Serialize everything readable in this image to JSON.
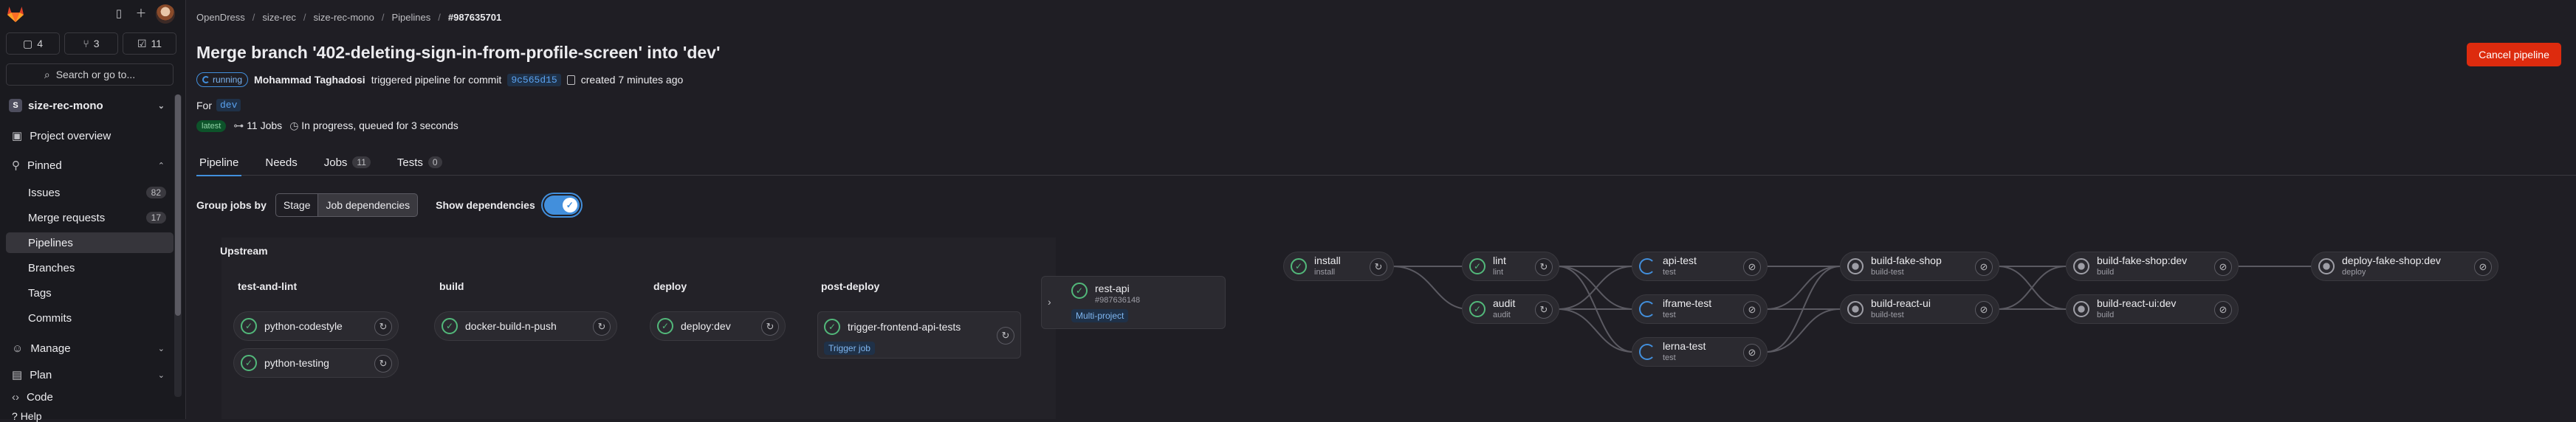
{
  "sidebar": {
    "counts": [
      {
        "icon": "issues-icon",
        "value": "4"
      },
      {
        "icon": "merge-request-icon",
        "value": "3"
      },
      {
        "icon": "todo-icon",
        "value": "11"
      }
    ],
    "search_label": "Search or go to...",
    "project": {
      "avatar_letter": "S",
      "name": "size-rec-mono"
    },
    "project_overview": "Project overview",
    "pinned_label": "Pinned",
    "pinned_items": [
      {
        "label": "Issues",
        "badge": "82"
      },
      {
        "label": "Merge requests",
        "badge": "17"
      },
      {
        "label": "Pipelines",
        "badge": ""
      },
      {
        "label": "Branches",
        "badge": ""
      },
      {
        "label": "Tags",
        "badge": ""
      },
      {
        "label": "Commits",
        "badge": ""
      }
    ],
    "manage_label": "Manage",
    "plan_label": "Plan",
    "code_label": "Code",
    "help_label": "Help"
  },
  "breadcrumb": [
    "OpenDress",
    "size-rec",
    "size-rec-mono",
    "Pipelines",
    "#987635701"
  ],
  "header": {
    "title": "Merge branch '402-deleting-sign-in-from-profile-screen' into 'dev'",
    "cancel_label": "Cancel pipeline",
    "status_label": "running",
    "author": "Mohammad Taghadosi",
    "trigger_text": "triggered pipeline for commit",
    "commit_sha": "9c565d15",
    "created_text": "created 7 minutes ago",
    "for_label": "For",
    "ref": "dev",
    "latest_badge": "latest",
    "jobs_text": "11 Jobs",
    "progress_text": "In progress, queued for 3 seconds"
  },
  "tabs": [
    {
      "label": "Pipeline",
      "count": ""
    },
    {
      "label": "Needs",
      "count": ""
    },
    {
      "label": "Jobs",
      "count": "11"
    },
    {
      "label": "Tests",
      "count": "0"
    }
  ],
  "controls": {
    "group_label": "Group jobs by",
    "stage_option": "Stage",
    "deps_option": "Job dependencies",
    "show_deps_label": "Show dependencies",
    "show_deps_on": true
  },
  "upstream": {
    "label": "Upstream",
    "stages": [
      "test-and-lint",
      "build",
      "deploy",
      "post-deploy"
    ],
    "jobs": {
      "python_codestyle": "python-codestyle",
      "python_testing": "python-testing",
      "docker_build": "docker-build-n-push",
      "deploy_dev": "deploy:dev",
      "trigger_frontend": "trigger-frontend-api-tests",
      "trigger_badge": "Trigger job"
    },
    "linked": {
      "name": "rest-api",
      "id": "#987636148",
      "badge": "Multi-project"
    }
  },
  "graph": {
    "install": {
      "name": "install",
      "stage": "install"
    },
    "lint": {
      "name": "lint",
      "stage": "lint"
    },
    "audit": {
      "name": "audit",
      "stage": "audit"
    },
    "api_test": {
      "name": "api-test",
      "stage": "test"
    },
    "iframe_test": {
      "name": "iframe-test",
      "stage": "test"
    },
    "lerna_test": {
      "name": "lerna-test",
      "stage": "test"
    },
    "build_fake_shop": {
      "name": "build-fake-shop",
      "stage": "build-test"
    },
    "build_react_ui": {
      "name": "build-react-ui",
      "stage": "build-test"
    },
    "build_fake_shop_dev": {
      "name": "build-fake-shop:dev",
      "stage": "build"
    },
    "build_react_ui_dev": {
      "name": "build-react-ui:dev",
      "stage": "build"
    },
    "deploy_fake_shop_dev": {
      "name": "deploy-fake-shop:dev",
      "stage": "deploy"
    }
  },
  "colors": {
    "success": "#52b87a",
    "running": "#428fdc",
    "created": "#9e9ea6",
    "danger": "#dd2b0e"
  }
}
